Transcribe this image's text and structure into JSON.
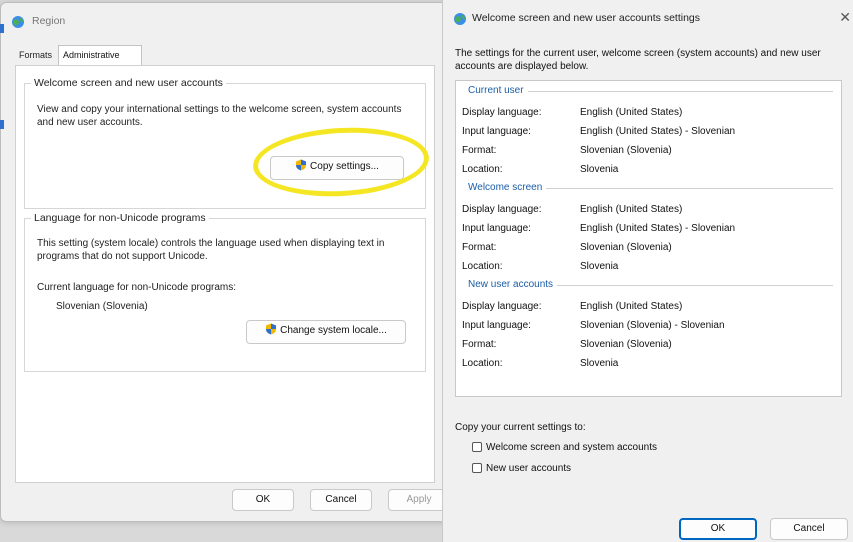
{
  "region": {
    "title": "Region",
    "tabs": [
      {
        "label": "Formats"
      },
      {
        "label": "Administrative"
      }
    ],
    "welcome_group": {
      "legend": "Welcome screen and new user accounts",
      "description": "View and copy your international settings to the welcome screen, system accounts and new user accounts.",
      "copy_button": "Copy settings..."
    },
    "unicode_group": {
      "legend": "Language for non-Unicode programs",
      "description": "This setting (system locale) controls the language used when displaying text in programs that do not support Unicode.",
      "current_label": "Current language for non-Unicode programs:",
      "current_value": "Slovenian (Slovenia)",
      "change_button": "Change system locale..."
    },
    "buttons": {
      "ok": "OK",
      "cancel": "Cancel",
      "apply": "Apply"
    }
  },
  "welcome_dialog": {
    "title": "Welcome screen and new user accounts settings",
    "close_glyph": "✕",
    "intro": "The settings for the current user, welcome screen (system accounts) and new user accounts are displayed below.",
    "sections": [
      {
        "title": "Current user",
        "rows": [
          {
            "label": "Display language:",
            "value": "English (United States)"
          },
          {
            "label": "Input language:",
            "value": "English (United States) - Slovenian"
          },
          {
            "label": "Format:",
            "value": "Slovenian (Slovenia)"
          },
          {
            "label": "Location:",
            "value": "Slovenia"
          }
        ]
      },
      {
        "title": "Welcome screen",
        "rows": [
          {
            "label": "Display language:",
            "value": "English (United States)"
          },
          {
            "label": "Input language:",
            "value": "English (United States) - Slovenian"
          },
          {
            "label": "Format:",
            "value": "Slovenian (Slovenia)"
          },
          {
            "label": "Location:",
            "value": "Slovenia"
          }
        ]
      },
      {
        "title": "New user accounts",
        "rows": [
          {
            "label": "Display language:",
            "value": "English (United States)"
          },
          {
            "label": "Input language:",
            "value": "Slovenian (Slovenia) - Slovenian"
          },
          {
            "label": "Format:",
            "value": "Slovenian (Slovenia)"
          },
          {
            "label": "Location:",
            "value": "Slovenia"
          }
        ]
      }
    ],
    "copy_label": "Copy your current settings to:",
    "checkboxes": [
      {
        "label": "Welcome screen and system accounts",
        "checked": false
      },
      {
        "label": "New user accounts",
        "checked": false
      }
    ],
    "buttons": {
      "ok": "OK",
      "cancel": "Cancel"
    }
  },
  "colors": {
    "accent": "#0067c0",
    "section_title": "#1a5ea8",
    "highlight": "#f5e624"
  },
  "icons": [
    "globe-icon",
    "shield-icon",
    "close-icon"
  ]
}
